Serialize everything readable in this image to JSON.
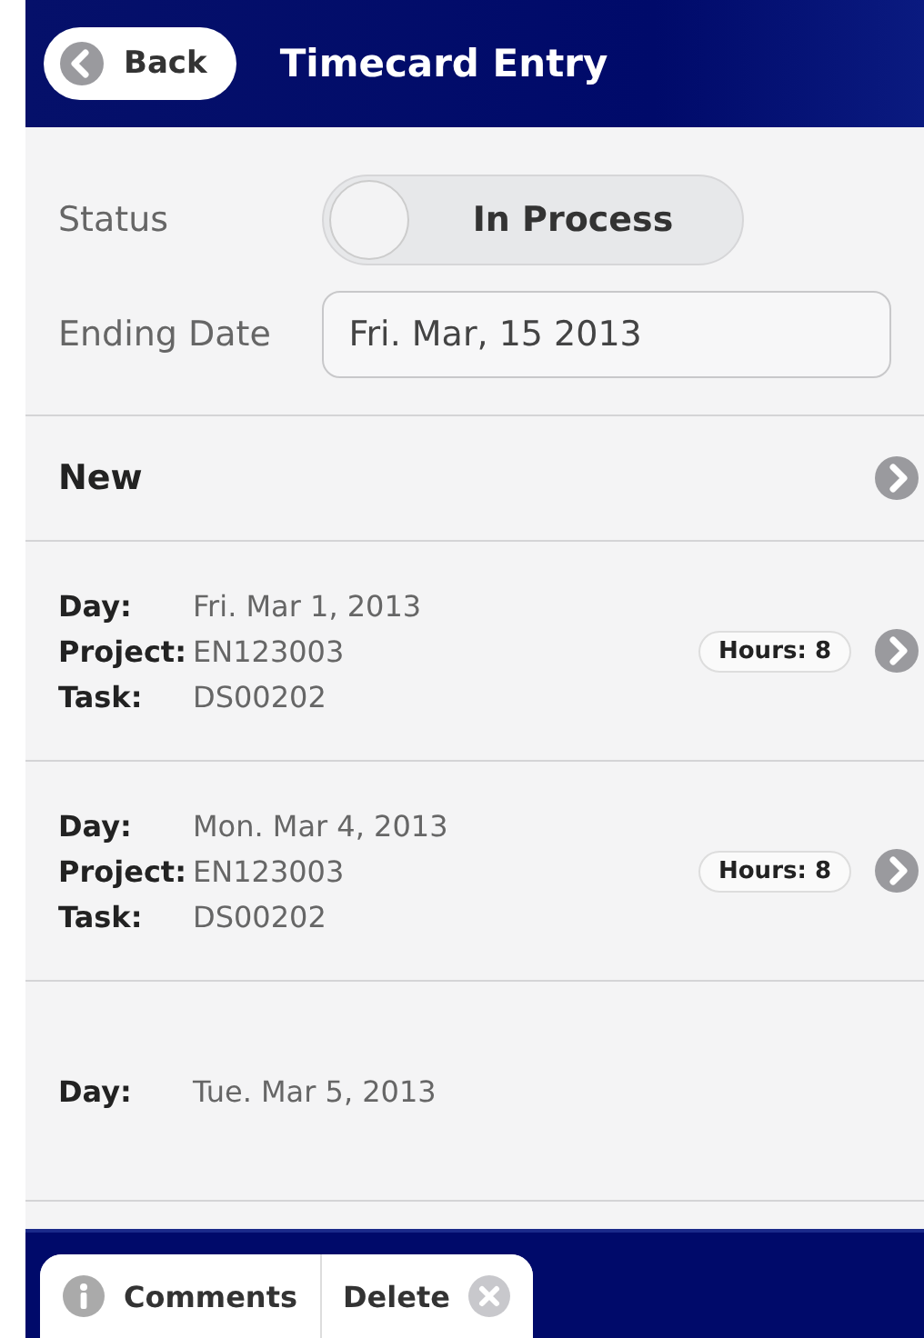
{
  "header": {
    "back_button": "Back",
    "title": "Timecard Entry"
  },
  "status": {
    "label": "Status",
    "toggle": {
      "text": "In Process",
      "on": false
    }
  },
  "ending_date": {
    "label": "Ending Date",
    "value": "Fri. Mar, 15 2013"
  },
  "new_row": {
    "label": "New"
  },
  "entries": [
    {
      "day_label": "Day:",
      "day": "Fri. Mar 1, 2013",
      "project_label": "Project:",
      "project": "EN123003",
      "task_label": "Task:",
      "task": "DS00202",
      "hours": "Hours: 8"
    },
    {
      "day_label": "Day:",
      "day": "Mon. Mar 4, 2013",
      "project_label": "Project:",
      "project": "EN123003",
      "task_label": "Task:",
      "task": "DS00202",
      "hours": "Hours: 8"
    },
    {
      "day_label": "Day:",
      "day": "Tue. Mar 5, 2013"
    }
  ],
  "toolbar": {
    "buttons": [
      {
        "kind": "info",
        "label": "Comments"
      },
      {
        "kind": "delete",
        "label": "Delete"
      }
    ]
  }
}
